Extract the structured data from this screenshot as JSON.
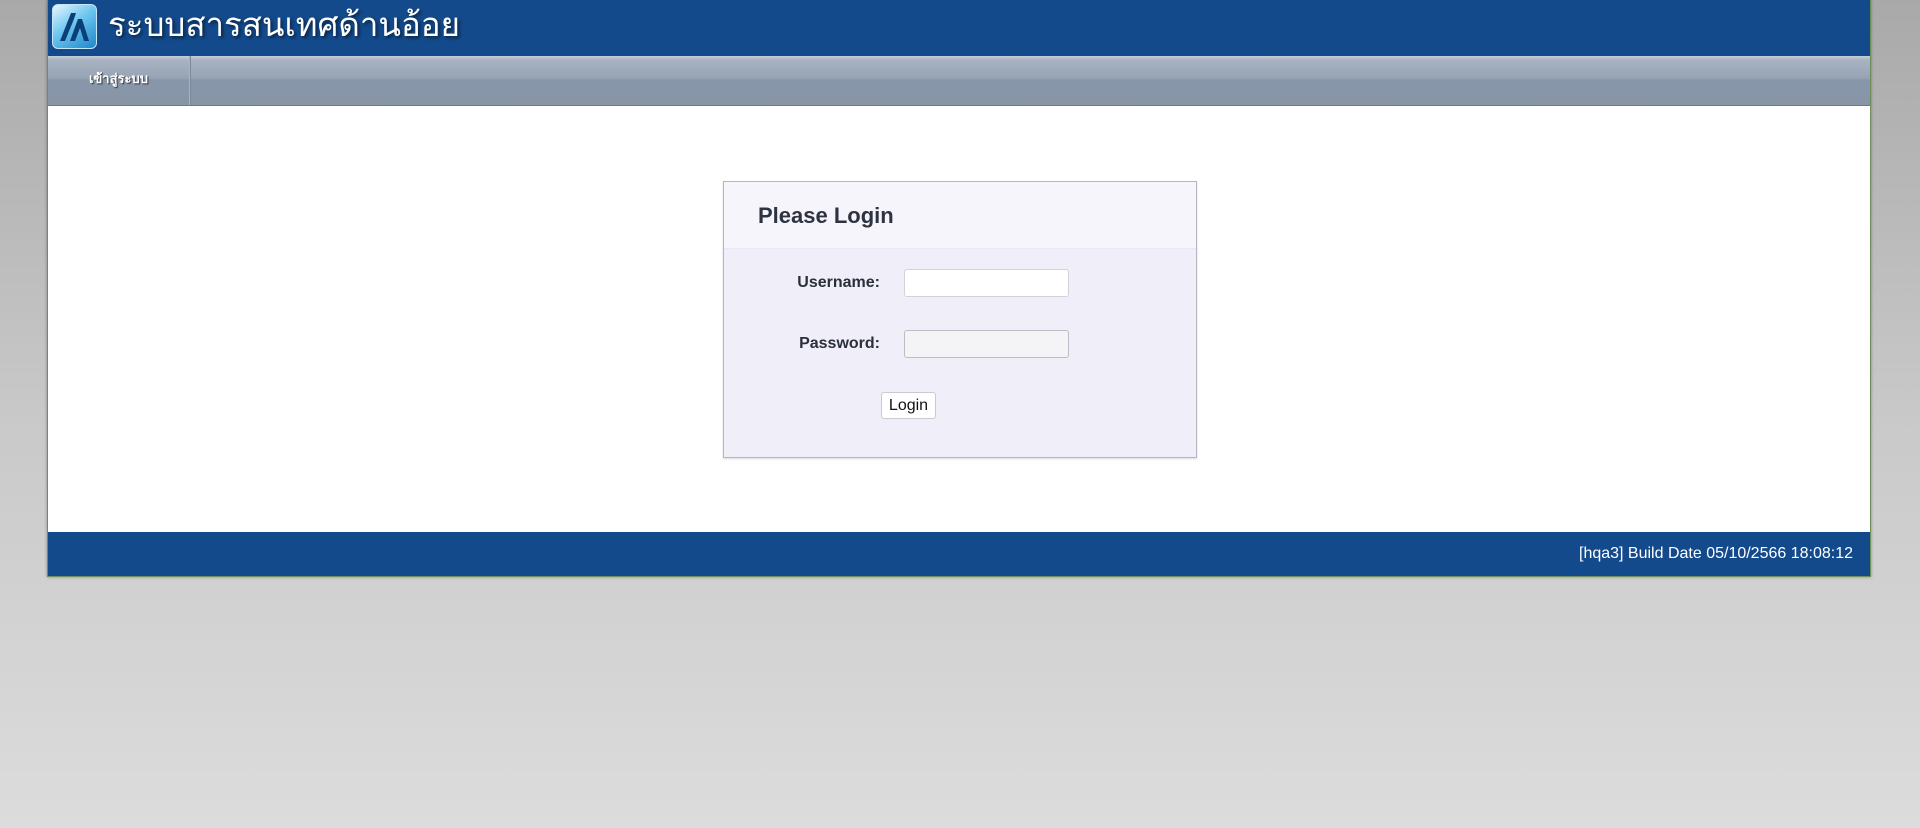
{
  "header": {
    "app_title": "ระบบสารสนเทศด้านอ้อย",
    "logo_icon": "logo-icon"
  },
  "navbar": {
    "items": [
      {
        "label": "เข้าสู่ระบบ"
      }
    ]
  },
  "login": {
    "title": "Please Login",
    "username_label": "Username:",
    "username_value": "",
    "password_label": "Password:",
    "password_value": "",
    "button_label": "Login"
  },
  "footer": {
    "build_info": "[hqa3] Build Date 05/10/2566 18:08:12"
  },
  "colors": {
    "header_bg": "#134a8c",
    "footer_bg": "#134a8c",
    "navbar_bg": "#8796a9",
    "login_box_bg": "#f0eff9"
  }
}
